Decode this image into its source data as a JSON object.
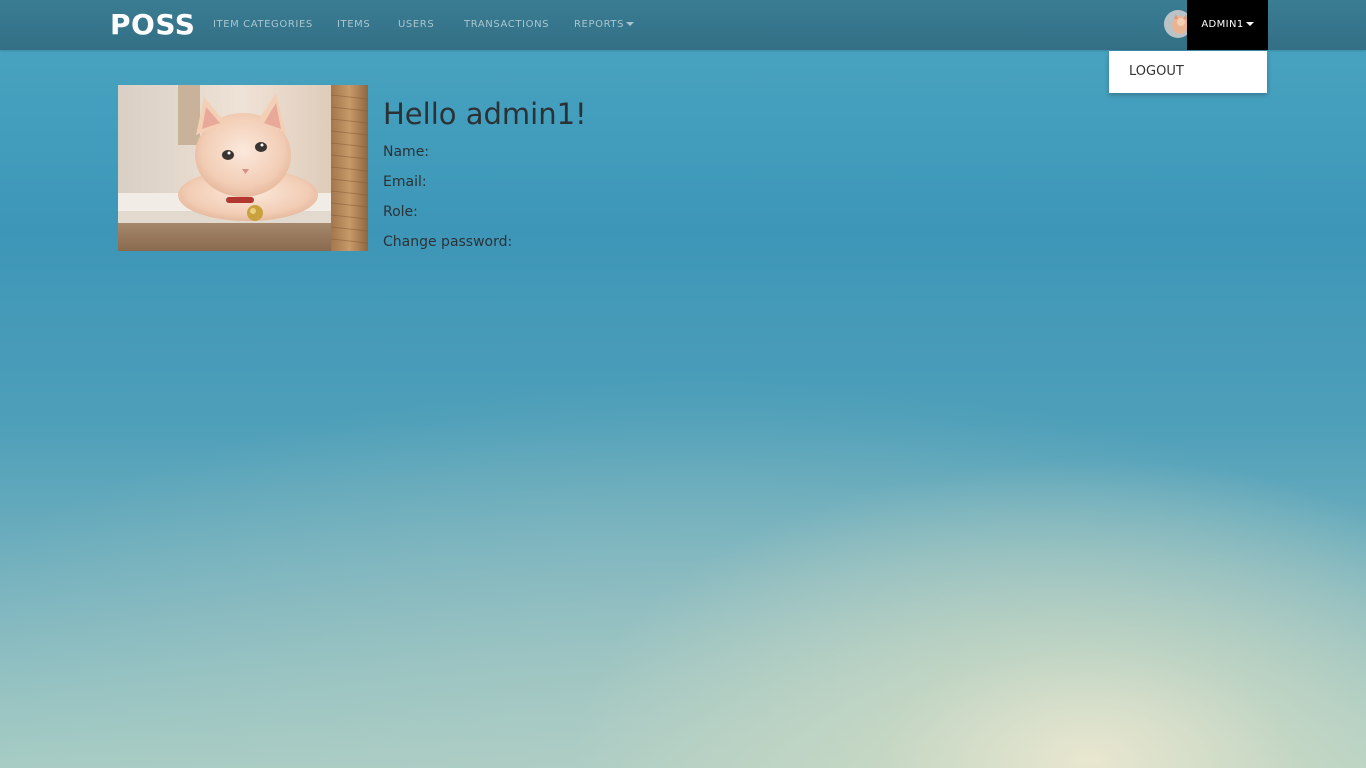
{
  "brand": "POSS",
  "nav": {
    "items": [
      {
        "label": "ITEM CATEGORIES"
      },
      {
        "label": "ITEMS"
      },
      {
        "label": "USERS"
      },
      {
        "label": "TRANSACTIONS"
      },
      {
        "label": "REPORTS"
      }
    ]
  },
  "user_menu": {
    "username": "ADMIN1",
    "dropdown": [
      {
        "label": "LOGOUT"
      }
    ]
  },
  "profile": {
    "greeting": "Hello admin1!",
    "fields": [
      {
        "label": "Name:"
      },
      {
        "label": "Email:"
      },
      {
        "label": "Role:"
      },
      {
        "label": "Change password:"
      }
    ]
  },
  "colors": {
    "navbar": "#3a7d93",
    "nav_text": "#a9c6cf",
    "active_toggle": "#000000",
    "body_text": "#2b3236"
  },
  "icons": {
    "caret": "caret-down-icon",
    "avatar": "avatar-icon"
  }
}
